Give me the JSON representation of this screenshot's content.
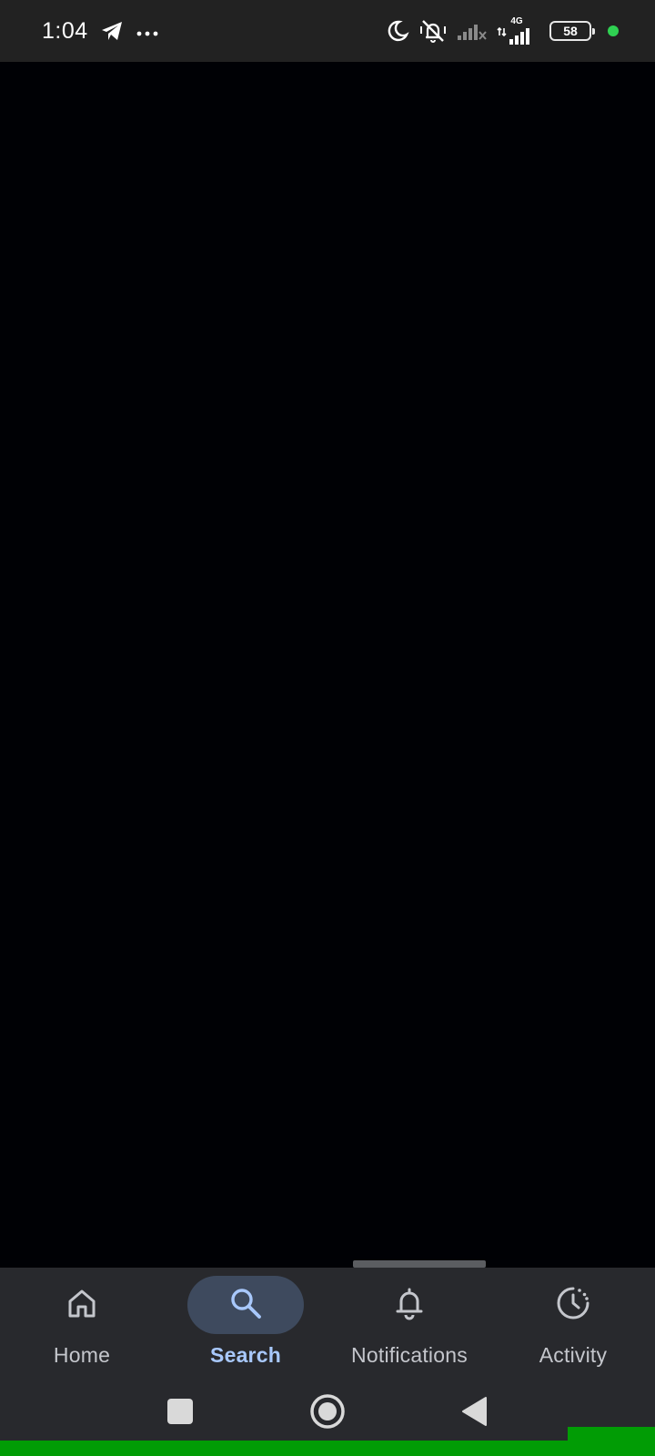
{
  "status_bar": {
    "time": "1:04",
    "left_icons": [
      "telegram-icon",
      "more-dots-icon"
    ],
    "right_icons": [
      "do-not-disturb-moon-icon",
      "vibrate-off-icon",
      "signal-no-service-icon",
      "signal-4g-icon",
      "battery-icon"
    ],
    "network_type": "4G",
    "battery_level": "58",
    "privacy_indicator_color": "#2fd152"
  },
  "bottom_nav": {
    "items": [
      {
        "label": "Home",
        "icon": "home-icon",
        "active": false
      },
      {
        "label": "Search",
        "icon": "search-icon",
        "active": true
      },
      {
        "label": "Notifications",
        "icon": "bell-icon",
        "active": false
      },
      {
        "label": "Activity",
        "icon": "activity-clock-icon",
        "active": false
      }
    ],
    "active_color": "#a8c8fb",
    "inactive_color": "#c4c6cc"
  },
  "system_nav": {
    "buttons": [
      "recents-square-icon",
      "home-circle-icon",
      "back-triangle-icon"
    ]
  },
  "colors": {
    "background": "#000105",
    "nav_background": "#28292d",
    "status_background": "#222222",
    "active_pill": "#3e4a5e",
    "green_strip": "#019c05"
  }
}
